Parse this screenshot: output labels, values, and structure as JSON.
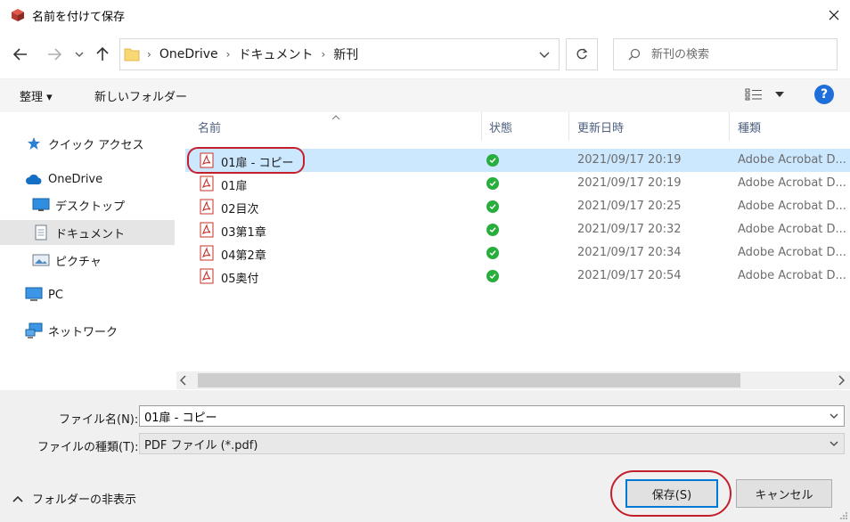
{
  "window": {
    "title": "名前を付けて保存"
  },
  "breadcrumb": [
    "OneDrive",
    "ドキュメント",
    "新刊"
  ],
  "search": {
    "placeholder": "新刊の検索"
  },
  "toolbar": {
    "organize_label": "整理 ▾",
    "new_folder_label": "新しいフォルダー"
  },
  "sidebar": {
    "items": [
      {
        "label": "クイック アクセス",
        "icon": "star-icon"
      },
      {
        "label": "OneDrive",
        "icon": "cloud-icon"
      },
      {
        "label": "デスクトップ",
        "icon": "desktop-icon"
      },
      {
        "label": "ドキュメント",
        "icon": "document-icon"
      },
      {
        "label": "ピクチャ",
        "icon": "picture-icon"
      },
      {
        "label": "PC",
        "icon": "pc-icon"
      },
      {
        "label": "ネットワーク",
        "icon": "network-icon"
      }
    ]
  },
  "columns": {
    "name": "名前",
    "status": "状態",
    "date": "更新日時",
    "type": "種類"
  },
  "files": [
    {
      "name": "01扉 - コピー",
      "date": "2021/09/17 20:19",
      "type": "Adobe Acrobat D..."
    },
    {
      "name": "01扉",
      "date": "2021/09/17 20:19",
      "type": "Adobe Acrobat D..."
    },
    {
      "name": "02目次",
      "date": "2021/09/17 20:25",
      "type": "Adobe Acrobat D..."
    },
    {
      "name": "03第1章",
      "date": "2021/09/17 20:32",
      "type": "Adobe Acrobat D..."
    },
    {
      "name": "04第2章",
      "date": "2021/09/17 20:34",
      "type": "Adobe Acrobat D..."
    },
    {
      "name": "05奥付",
      "date": "2021/09/17 20:54",
      "type": "Adobe Acrobat D..."
    }
  ],
  "form": {
    "filename_label": "ファイル名(N):",
    "filename_value": "01扉 - コピー",
    "filetype_label": "ファイルの種類(T):",
    "filetype_value": "PDF ファイル (*.pdf)"
  },
  "footer": {
    "hide_folders_label": "フォルダーの非表示",
    "save_label": "保存(S)",
    "cancel_label": "キャンセル"
  },
  "colors": {
    "selection": "#cce8ff",
    "highlight_ring": "#c31f2b",
    "accent": "#0078d7",
    "sync_ok": "#27ae3c"
  }
}
